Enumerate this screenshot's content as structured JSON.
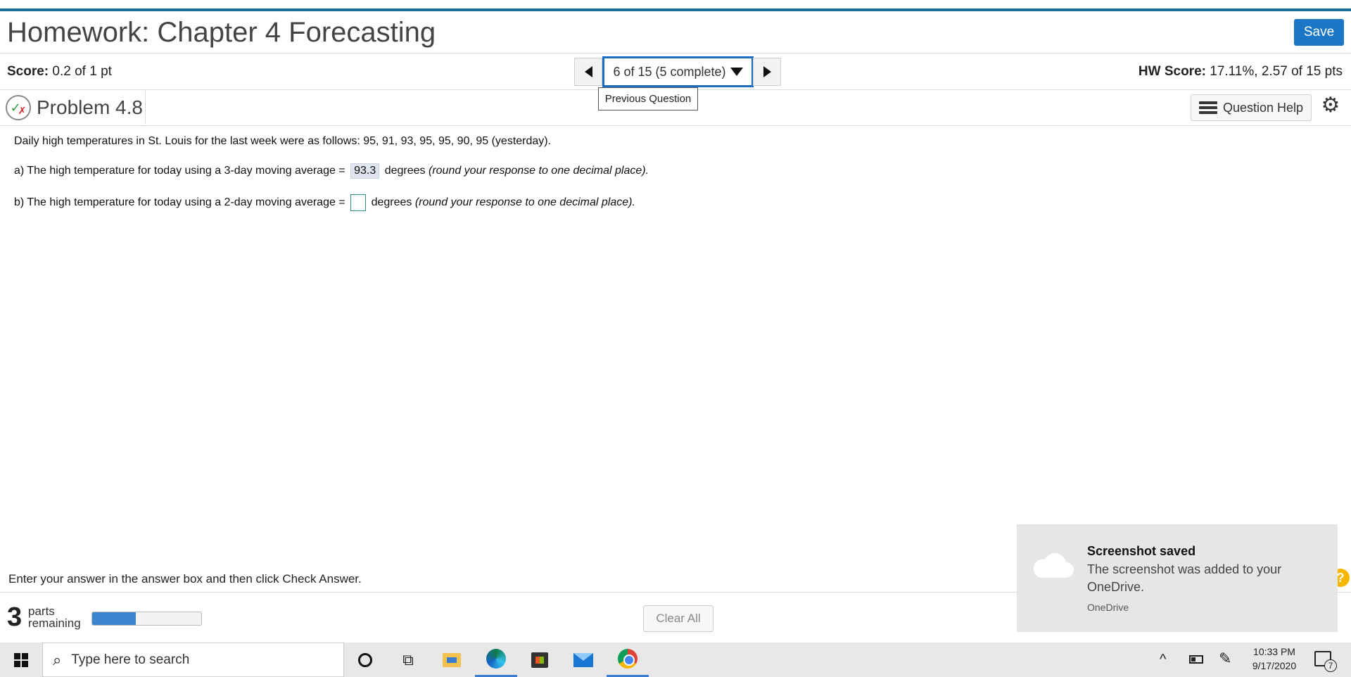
{
  "header": {
    "title": "Homework: Chapter 4 Forecasting",
    "save_label": "Save"
  },
  "scorebar": {
    "score_label": "Score:",
    "score_value": "0.2 of 1 pt",
    "question_selector": "6 of 15 (5 complete)",
    "hw_score_label": "HW Score:",
    "hw_score_value": "17.11%, 2.57 of 15 pts",
    "tooltip": "Previous Question"
  },
  "problem": {
    "title": "Problem 4.8",
    "question_help_label": "Question Help",
    "intro": "Daily high temperatures in St. Louis for the last week were as follows: 95, 91, 93, 95, 95, 90, 95 (yesterday).",
    "part_a_prefix": "a) The high temperature for today using a 3-day moving average =",
    "part_a_answer": "93.3",
    "part_a_suffix": "degrees",
    "part_a_hint": "(round your response to one decimal place).",
    "part_b_prefix": "b) The high temperature for today using a 2-day moving average =",
    "part_b_answer": "",
    "part_b_suffix": "degrees",
    "part_b_hint": "(round your response to one decimal place)."
  },
  "footer": {
    "instruction": "Enter your answer in the answer box and then click Check Answer.",
    "parts_count": "3",
    "parts_word": "parts",
    "remaining_word": "remaining",
    "progress_fraction": 0.4,
    "clear_all_label": "Clear All",
    "help_glyph": "?"
  },
  "toast": {
    "title": "Screenshot saved",
    "body": "The screenshot was added to your OneDrive.",
    "app": "OneDrive"
  },
  "taskbar": {
    "search_placeholder": "Type here to search",
    "time": "10:33 PM",
    "date": "9/17/2020",
    "notification_count": "7"
  },
  "colors": {
    "accent_blue": "#1b77c6",
    "top_border": "#1a6f9a",
    "progress_fill": "#3d84cf"
  }
}
